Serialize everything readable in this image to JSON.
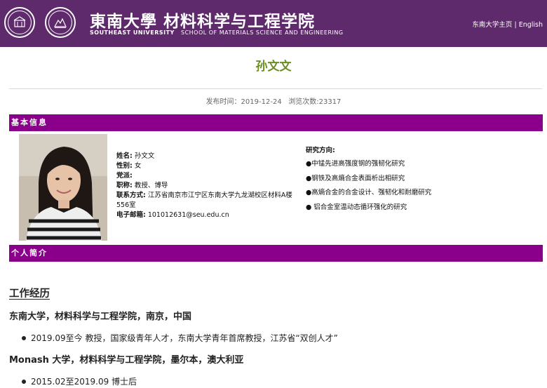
{
  "header": {
    "brand_cn": "東南大學 材料科学与工程学院",
    "brand_en_univ": "SOUTHEAST UNIVERSITY",
    "brand_en_school": "SCHOOL OF MATERIALS SCIENCE AND ENGINEERING",
    "link_home": "东南大学主页",
    "separator": "|",
    "link_english": "English",
    "header_bg": "#5e2a6b"
  },
  "page": {
    "title": "孙文文",
    "publish_date": "发布时间：2019-12-24",
    "view_count": "浏览次数:23317",
    "title_color": "#6b8e23",
    "bar_color": "#8b008b"
  },
  "basic": {
    "bar_label": "基本信息",
    "name_label": "姓名:",
    "name_value": "孙文文",
    "gender_label": "性别:",
    "gender_value": "女",
    "party_label": "党派:",
    "party_value": "",
    "position_label": "职称:",
    "position_value": "教授、博导",
    "contact_label": "联系方式:",
    "contact_value": "江苏省南京市江宁区东南大学九龙湖校区材料A楼556室",
    "email_label": "电子邮箱:",
    "email_value": "101012631@seu.edu.cn"
  },
  "research": {
    "title": "研究方向:",
    "items": [
      "●中锰先进高强度钢的强韧化研究",
      "●钢铁及高熵合金表面析出相研究",
      "●高熵合金的合金设计、强韧化和耐磨研究",
      "● 铝合金室温动态循环强化的研究"
    ]
  },
  "profile": {
    "bar_label": "个人简介",
    "heading": "工作经历",
    "org1": "东南大学，材料科学与工程学院，南京，中国",
    "org1_item": "2019.09至今 教授，国家级青年人才，东南大学青年首席教授，江苏省“双创人才”",
    "org2": "Monash 大学，材料科学与工程学院，墨尔本，澳大利亚",
    "org2_item": "2015.02至2019.09 博士后"
  },
  "icons": {
    "seal1": "university-seal-icon",
    "seal2": "school-seal-icon"
  }
}
